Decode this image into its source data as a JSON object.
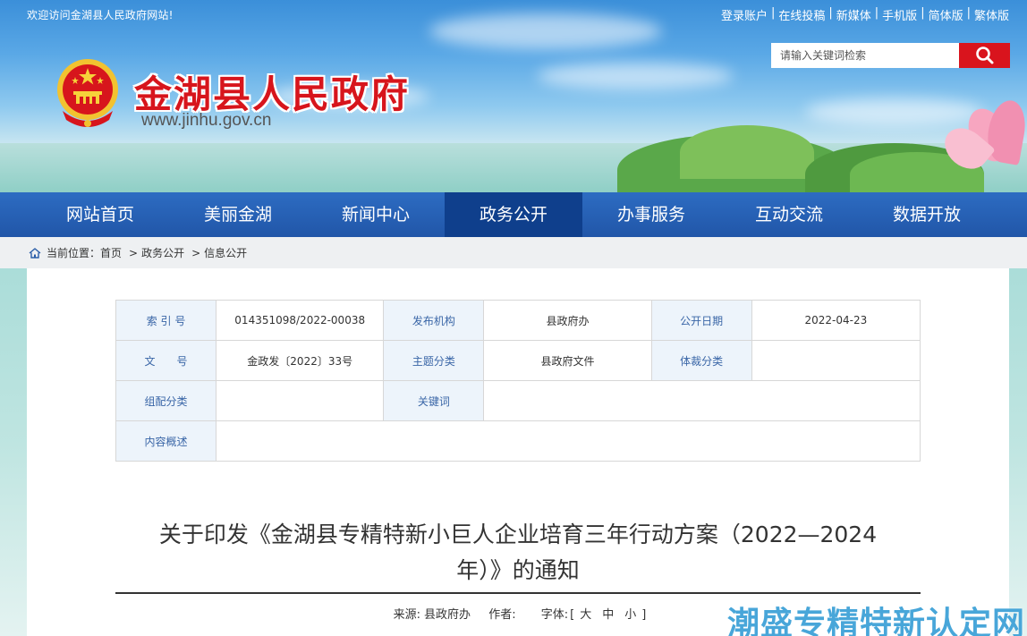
{
  "header": {
    "welcome": "欢迎访问金湖县人民政府网站!",
    "top_links": [
      "登录账户",
      "在线投稿",
      "新媒体",
      "手机版",
      "简体版",
      "繁体版"
    ],
    "site_title": "金湖县人民政府",
    "site_url": "www.jinhu.gov.cn",
    "search_placeholder": "请输入关键词检索"
  },
  "nav": {
    "items": [
      "网站首页",
      "美丽金湖",
      "新闻中心",
      "政务公开",
      "办事服务",
      "互动交流",
      "数据开放"
    ],
    "active": "政务公开"
  },
  "breadcrumb": {
    "prefix": "当前位置：",
    "items": [
      "首页",
      "政务公开",
      "信息公开"
    ]
  },
  "meta_table": {
    "index_label": "索 引 号",
    "index_value": "014351098/2022-00038",
    "publisher_label": "发布机构",
    "publisher_value": "县政府办",
    "date_label": "公开日期",
    "date_value": "2022-04-23",
    "docno_label": "文　　号",
    "docno_value": "金政发〔2022〕33号",
    "topic_label": "主题分类",
    "topic_value": "县政府文件",
    "genre_label": "体裁分类",
    "genre_value": "",
    "org_label": "组配分类",
    "org_value": "",
    "keyword_label": "关键词",
    "keyword_value": "",
    "summary_label": "内容概述",
    "summary_value": ""
  },
  "article": {
    "title_line1": "关于印发《金湖县专精特新小巨人企业培育三年行动方案（2022—2024",
    "title_line2": "年）》的通知",
    "source_label": "来源:",
    "source_value": "县政府办",
    "author_label": "作者:",
    "font_label": "字体:",
    "font_open": "[",
    "font_large": "大",
    "font_medium": "中",
    "font_small": "小",
    "font_close": "]"
  },
  "watermark": "潮盛专精特新认定网",
  "colors": {
    "brand_red": "#d7151c",
    "nav_blue": "#2156a8",
    "nav_active": "#0f3f8c",
    "label_blue": "#3a66a7"
  }
}
